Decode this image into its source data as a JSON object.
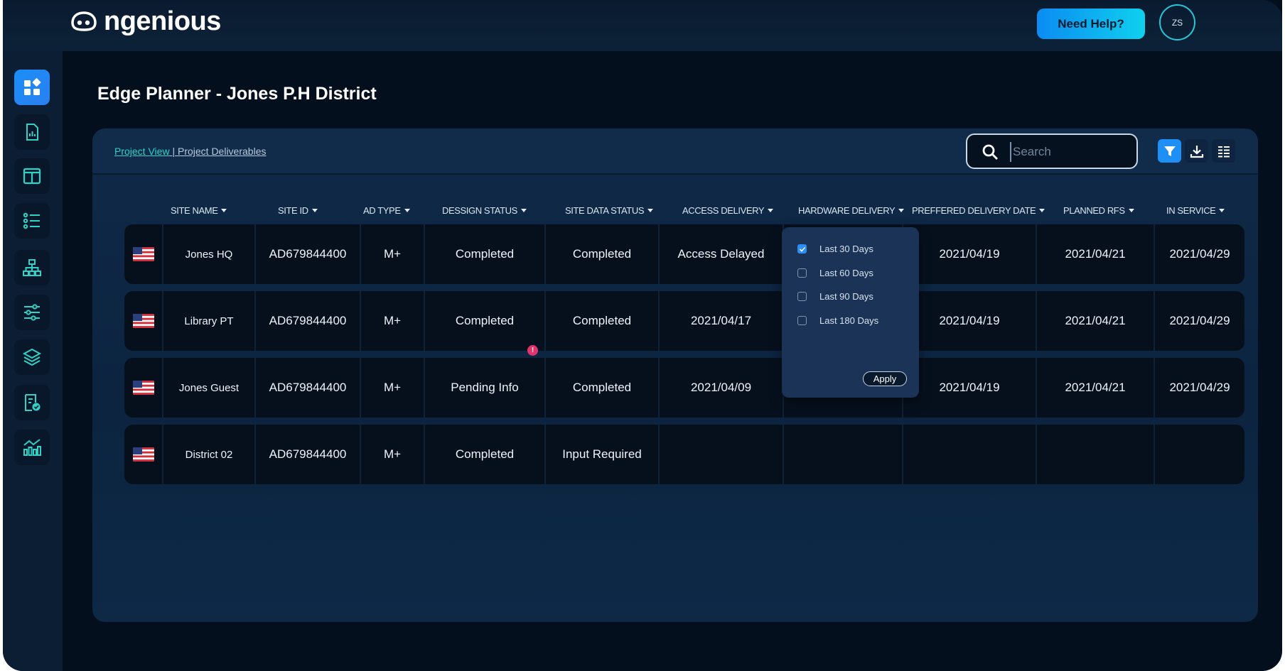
{
  "app": {
    "logo_text": "ngenious",
    "help_label": "Need Help?",
    "avatar_initials": "ZS",
    "accent_color": "#1d8ff5",
    "teal_color": "#2ed0c8"
  },
  "sidebar": {
    "items": [
      {
        "icon": "dashboard-icon",
        "active": true
      },
      {
        "icon": "report-icon",
        "active": false
      },
      {
        "icon": "columns-icon",
        "active": false
      },
      {
        "icon": "list-icon",
        "active": false
      },
      {
        "icon": "network-icon",
        "active": false
      },
      {
        "icon": "sliders-icon",
        "active": false
      },
      {
        "icon": "layers-icon",
        "active": false
      },
      {
        "icon": "checklist-icon",
        "active": false
      },
      {
        "icon": "analytics-icon",
        "active": false
      }
    ]
  },
  "page": {
    "title": "Edge Planner - Jones P.H District"
  },
  "panel": {
    "breadcrumb_link": "Project View",
    "breadcrumb_rest": " | Project Deliverables",
    "search_placeholder": "Search"
  },
  "table": {
    "columns": [
      "SITE NAME",
      "SITE ID",
      "AD TYPE",
      "DESSIGN STATUS",
      "SITE DATA STATUS",
      "ACCESS DELIVERY",
      "HARDWARE DELIVERY",
      "PREFFERED DELIVERY DATE",
      "PLANNED RFS",
      "IN SERVICE"
    ],
    "rows": [
      {
        "site_name": "Jones HQ",
        "site_id": "AD679844400",
        "ad_type": "M+",
        "design_status": "Completed",
        "site_data_status": "Completed",
        "access_delivery": "Access Delayed",
        "hardware_delivery": "",
        "preferred_delivery_date": "2021/04/19",
        "planned_rfs": "2021/04/21",
        "in_service": "2021/04/29",
        "alert": ""
      },
      {
        "site_name": "Library PT",
        "site_id": "AD679844400",
        "ad_type": "M+",
        "design_status": "Completed",
        "site_data_status": "Completed",
        "access_delivery": "2021/04/17",
        "hardware_delivery": "",
        "preferred_delivery_date": "2021/04/19",
        "planned_rfs": "2021/04/21",
        "in_service": "2021/04/29",
        "alert": ""
      },
      {
        "site_name": "Jones Guest",
        "site_id": "AD679844400",
        "ad_type": "M+",
        "design_status": "Pending Info",
        "site_data_status": "Completed",
        "access_delivery": "2021/04/09",
        "hardware_delivery": "",
        "preferred_delivery_date": "2021/04/19",
        "planned_rfs": "2021/04/21",
        "in_service": "2021/04/29",
        "alert": "!"
      },
      {
        "site_name": "District 02",
        "site_id": "AD679844400",
        "ad_type": "M+",
        "design_status": "Completed",
        "site_data_status": "Input Required",
        "access_delivery": "",
        "hardware_delivery": "",
        "preferred_delivery_date": "",
        "planned_rfs": "",
        "in_service": "",
        "alert": ""
      }
    ]
  },
  "filter_dropdown": {
    "options": [
      {
        "label": "Last 30 Days",
        "checked": true
      },
      {
        "label": "Last 60 Days",
        "checked": false
      },
      {
        "label": "Last 90 Days",
        "checked": false
      },
      {
        "label": "Last 180 Days",
        "checked": false
      }
    ],
    "apply_label": "Apply"
  }
}
